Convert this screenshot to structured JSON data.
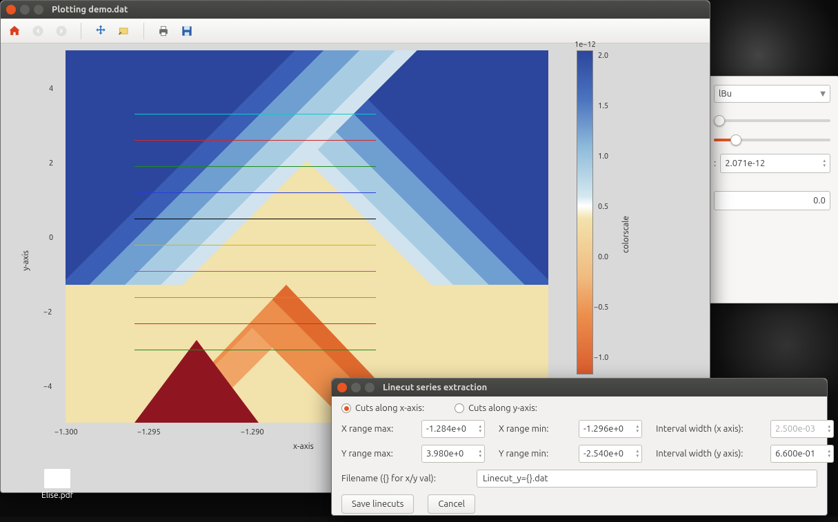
{
  "window": {
    "title": "Plotting demo.dat"
  },
  "toolbar": {
    "home": "home",
    "back": "back",
    "forward": "forward",
    "pan": "pan",
    "zoom": "zoom",
    "print": "print",
    "save": "save"
  },
  "chart_data": {
    "type": "heatmap",
    "xlabel": "x-axis",
    "ylabel": "y-axis",
    "colorbar_label": "colorscale",
    "colorbar_exponent": "1e−12",
    "x_ticks": [
      "−1.300",
      "−1.295",
      "−1.290"
    ],
    "y_ticks": [
      "−4",
      "−2",
      "0",
      "2",
      "4"
    ],
    "colorbar_ticks": [
      "2.0",
      "1.5",
      "1.0",
      "0.5",
      "0.0",
      "−0.5",
      "−1.0"
    ],
    "xlim": [
      -1.3,
      -1.284
    ],
    "ylim": [
      -5,
      5
    ],
    "clim": [
      -1.2e-12,
      2.07e-12
    ],
    "linecut_y_values": [
      3.38,
      2.72,
      2.06,
      1.4,
      0.74,
      0.08,
      -0.58,
      -1.24,
      -1.9,
      -2.56
    ],
    "linecut_colors": [
      "#0ec9c9",
      "#d62626",
      "#1f8b1f",
      "#2b3dd8",
      "#000000",
      "#c7bb12",
      "#d333d3",
      "#19c2c2",
      "#cf2a2a",
      "#1f8b1f"
    ]
  },
  "side_panel": {
    "colormap_value": "lBu",
    "max_value": "2.071e-12",
    "offset_value": "0.0"
  },
  "dialog": {
    "title": "Linecut series extraction",
    "radio_x": "Cuts along x-axis:",
    "radio_y": "Cuts along y-axis:",
    "xrange_max_label": "X range max:",
    "xrange_max": "-1.284e+0",
    "xrange_min_label": "X range min:",
    "xrange_min": "-1.296e+0",
    "interval_x_label": "Interval width (x axis):",
    "interval_x": "2.500e-03",
    "yrange_max_label": "Y range max:",
    "yrange_max": "3.980e+0",
    "yrange_min_label": "Y range min:",
    "yrange_min": "-2.540e+0",
    "interval_y_label": "Interval width (y axis):",
    "interval_y": "6.600e-01",
    "filename_label": "Filename ({} for x/y val):",
    "filename": "Linecut_y={}.dat",
    "save_btn": "Save linecuts",
    "cancel_btn": "Cancel"
  },
  "desktop": {
    "file1": "Elise.pdf"
  }
}
